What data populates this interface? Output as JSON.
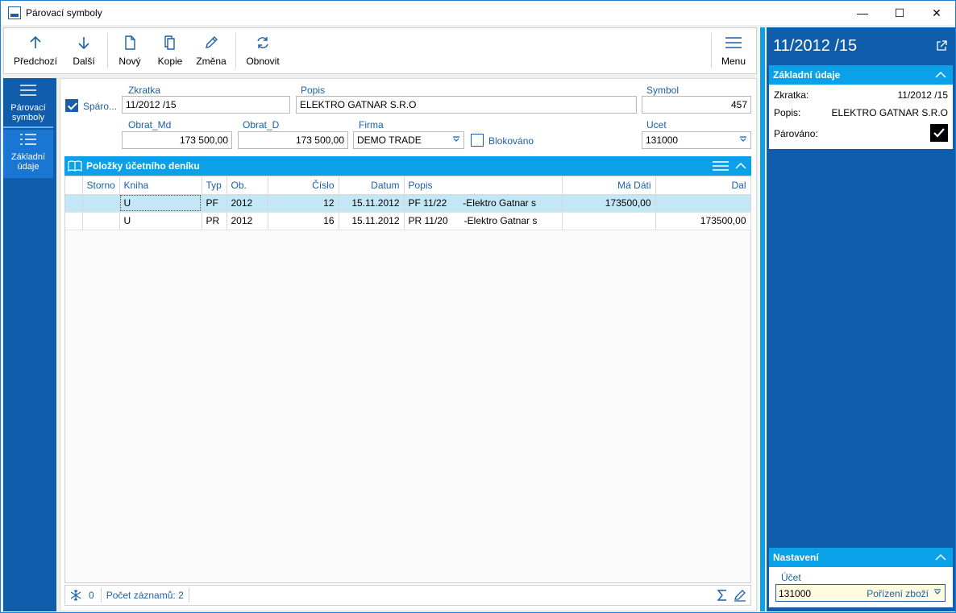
{
  "window": {
    "title": "Párovací symboly",
    "controls": [
      "—",
      "☐",
      "✕"
    ]
  },
  "toolbar": {
    "prev": "Předchozí",
    "next": "Další",
    "new": "Nový",
    "copy": "Kopie",
    "change": "Změna",
    "refresh": "Obnovit",
    "menu": "Menu"
  },
  "leftnav": {
    "items": [
      {
        "label": "Párovací symboly"
      },
      {
        "label": "Základní údaje"
      }
    ]
  },
  "form": {
    "sparovano_label": "Spáro...",
    "sparovano_checked": true,
    "zkratka_label": "Zkratka",
    "zkratka_value": "11/2012 /15",
    "popis_label": "Popis",
    "popis_value": "ELEKTRO GATNAR S.R.O",
    "symbol_label": "Symbol",
    "symbol_value": "457",
    "obrat_md_label": "Obrat_Md",
    "obrat_md_value": "173 500,00",
    "obrat_d_label": "Obrat_D",
    "obrat_d_value": "173 500,00",
    "firma_label": "Firma",
    "firma_value": "DEMO TRADE",
    "blokovano_label": "Blokováno",
    "blokovano_checked": false,
    "ucet_label": "Ucet",
    "ucet_value": "131000"
  },
  "grid": {
    "title": "Položky účetního deníku",
    "columns": [
      "Storno",
      "Kniha",
      "Typ",
      "Ob.",
      "Číslo",
      "Datum",
      "Popis",
      "Má Dáti",
      "Dal"
    ],
    "rows": [
      {
        "storno": "",
        "kniha": "U",
        "typ": "PF",
        "ob": "2012",
        "cislo": "12",
        "datum": "15.11.2012",
        "popis": "PF 11/22      -Elektro Gatnar s",
        "ma_dati": "173500,00",
        "dal": ""
      },
      {
        "storno": "",
        "kniha": "U",
        "typ": "PR",
        "ob": "2012",
        "cislo": "16",
        "datum": "15.11.2012",
        "popis": "PR 11/20      -Elektro Gatnar s",
        "ma_dati": "",
        "dal": "173500,00"
      }
    ],
    "status_count": "0",
    "status_records": "Počet záznamů: 2"
  },
  "rightpanel": {
    "title": "11/2012 /15",
    "basic_title": "Základní údaje",
    "zkratka_label": "Zkratka:",
    "zkratka_value": "11/2012 /15",
    "popis_label": "Popis:",
    "popis_value": "ELEKTRO GATNAR S.R.O",
    "parovano_label": "Párováno:",
    "parovano_checked": true,
    "settings_title": "Nastavení",
    "ucet_label": "Účet",
    "ucet_value": "131000",
    "ucet_hint": "Pořízení zboží"
  },
  "colors": {
    "accent": "#0aa1e8",
    "nav": "#0f5dab",
    "selected_row": "#c4e7f8",
    "label": "#1b5fa8"
  }
}
